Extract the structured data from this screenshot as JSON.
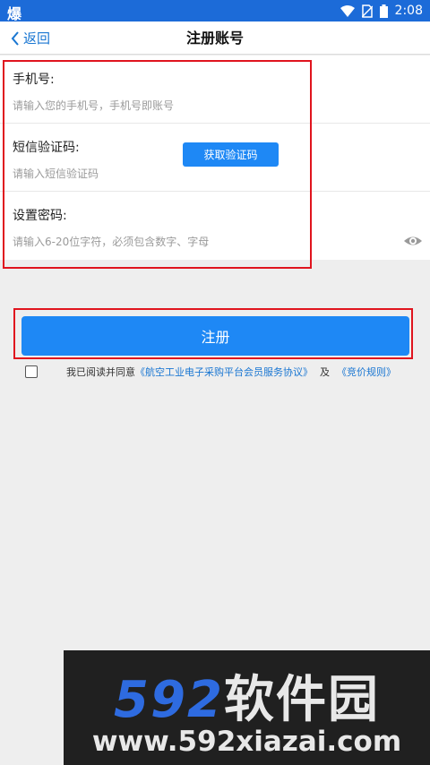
{
  "status_bar": {
    "app_glyph": "爆",
    "time": "2:08"
  },
  "header": {
    "back_label": "返回",
    "title": "注册账号"
  },
  "form": {
    "phone": {
      "label": "手机号:",
      "placeholder": "请输入您的手机号，手机号即账号",
      "value": ""
    },
    "sms_code": {
      "label": "短信验证码:",
      "placeholder": "请输入短信验证码",
      "value": "",
      "get_code_label": "获取验证码"
    },
    "password": {
      "label": "设置密码:",
      "placeholder": "请输入6-20位字符，必须包含数字、字母",
      "value": ""
    }
  },
  "register_label": "注册",
  "agreement": {
    "checked": false,
    "prefix": "我已阅读并同意",
    "link1": "《航空工业电子采购平台会员服务协议》",
    "middle": "及",
    "link2": "《竞价规则》"
  },
  "watermark": {
    "number": "592",
    "name": "软件园",
    "url": "www.592xiazai.com"
  },
  "colors": {
    "primary": "#1e88f5",
    "status_bar": "#1c6bd8",
    "link": "#1976d2",
    "highlight": "#e0141e"
  }
}
